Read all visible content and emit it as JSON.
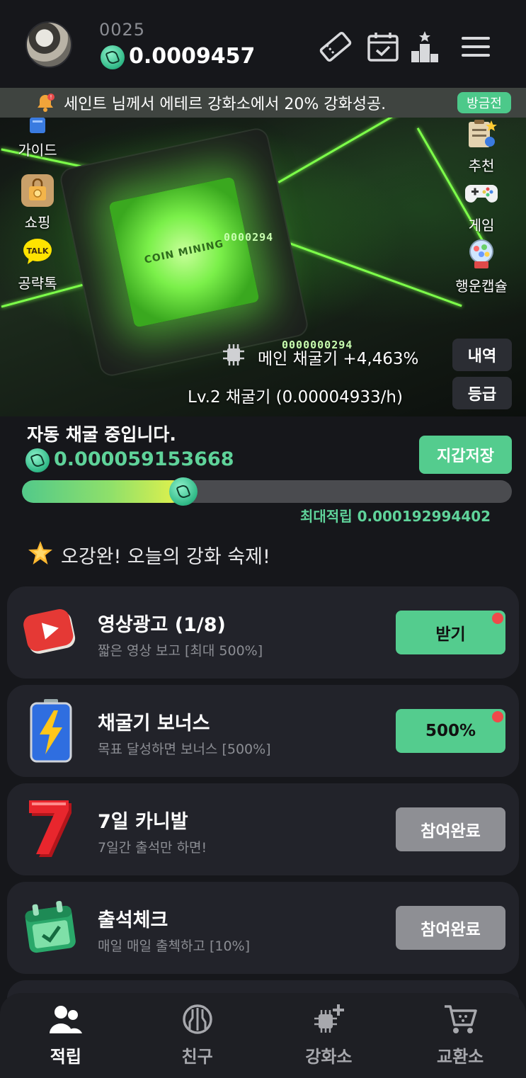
{
  "header": {
    "username": "0025",
    "balance": "0.0009457",
    "icons": [
      "ticket-icon",
      "calendar-check-icon",
      "ranking-icon",
      "menu-icon"
    ]
  },
  "notice": {
    "text": "세인트 님께서 에테르 강화소에서 20% 강화성공.",
    "badge": "방금전"
  },
  "hero": {
    "chip_brand": "COIN MINING",
    "overlay_number_1": "0000294",
    "overlay_number_2": "0000000294",
    "left_buttons": [
      {
        "label": "가이드",
        "icon": "guide-book-icon"
      },
      {
        "label": "쇼핑",
        "icon": "shopping-bag-icon"
      },
      {
        "label": "공략톡",
        "icon": "talk-icon"
      }
    ],
    "right_buttons": [
      {
        "label": "추천",
        "icon": "recommend-clipboard-icon"
      },
      {
        "label": "게임",
        "icon": "gamepad-icon"
      },
      {
        "label": "행운캡슐",
        "icon": "capsule-machine-icon"
      }
    ],
    "main_miner_text": "메인 채굴기 +4,463%",
    "level_text": "Lv.2 채굴기  (0.00004933/h)",
    "history_button": "내역",
    "grade_button": "등급"
  },
  "mining": {
    "title": "자동 채굴 중입니다.",
    "value": "0.000059153668",
    "wallet_button": "지갑저장",
    "progress": 0.33,
    "max_label": "최대적립 0.000192994402"
  },
  "festival": {
    "text": "오강완! 오늘의 강화 숙제!"
  },
  "cards": [
    {
      "title": "영상광고 (1/8)",
      "subtitle": "짧은 영상 보고 [최대 500%]",
      "button": "받기",
      "button_style": "green",
      "dot": true,
      "icon": "video-play-icon"
    },
    {
      "title": "채굴기 보너스",
      "subtitle": "목표 달성하면 보너스 [500%]",
      "button": "500%",
      "button_style": "green",
      "dot": true,
      "icon": "battery-bolt-icon"
    },
    {
      "title": "7일 카니발",
      "subtitle": "7일간 출석만 하면!",
      "button": "참여완료",
      "button_style": "gray",
      "dot": false,
      "icon": "seven-icon"
    },
    {
      "title": "출석체크",
      "subtitle": "매일 매일 출첵하고 [10%]",
      "button": "참여완료",
      "button_style": "gray",
      "dot": false,
      "icon": "attendance-calendar-icon"
    }
  ],
  "nav": [
    {
      "label": "적립",
      "icon": "people-icon",
      "active": true
    },
    {
      "label": "친구",
      "icon": "circuit-icon",
      "active": false
    },
    {
      "label": "강화소",
      "icon": "upgrade-chip-icon",
      "active": false
    },
    {
      "label": "교환소",
      "icon": "cart-icon",
      "active": false
    }
  ],
  "colors": {
    "accent_green": "#54cc8e",
    "text_green": "#5fd39a",
    "background": "#16171b",
    "card": "#22232a",
    "badge_dot": "#f04a4a"
  }
}
